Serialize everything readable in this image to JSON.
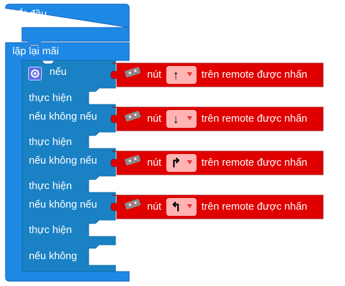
{
  "start_block": {
    "label": "bắt đầu"
  },
  "loop_block": {
    "label": "lặp lại mãi"
  },
  "if_block": {
    "if_label": "nếu",
    "then_label": "thực hiện",
    "elseif_label": "nếu không nếu",
    "else_label": "nếu không"
  },
  "conditions": [
    {
      "button_label": "nút",
      "arrow": "↑",
      "suffix": "trên remote được nhấn",
      "icon": "remote-icon"
    },
    {
      "button_label": "nút",
      "arrow": "↓",
      "suffix": "trên remote được nhấn",
      "icon": "remote-icon"
    },
    {
      "button_label": "nút",
      "arrow": "↱",
      "suffix": "trên remote được nhấn",
      "icon": "remote-icon"
    },
    {
      "button_label": "nút",
      "arrow": "↰",
      "suffix": "trên remote được nhấn",
      "icon": "remote-icon"
    }
  ],
  "colors": {
    "event": "#1e88e5",
    "control": "#1a81c4",
    "sensor": "#e00000",
    "dropdown": "#ffb3b3"
  }
}
